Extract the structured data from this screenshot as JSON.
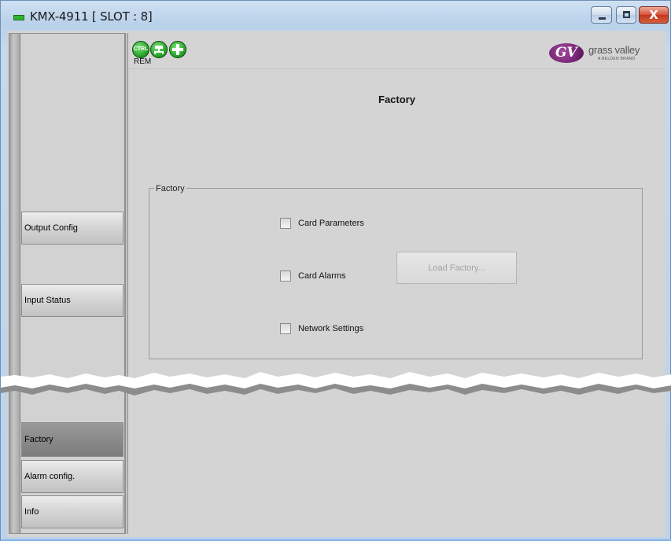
{
  "window": {
    "title": "KMX-4911 [ SLOT : 8]",
    "controls": {
      "minimize_icon": "minimize-icon",
      "maximize_icon": "maximize-icon",
      "close_glyph": "X"
    }
  },
  "status_icons": {
    "ctrl_text": "CTRL",
    "rem_text": "REM",
    "icons": [
      "ctrl-status-icon",
      "network-status-icon",
      "health-status-icon"
    ]
  },
  "logo": {
    "mark": "GV",
    "name": "grass valley",
    "tagline": "A BELDEN BRAND"
  },
  "nav": {
    "items": [
      {
        "label": "Output Config",
        "active": false
      },
      {
        "label": "Input Status",
        "active": false
      },
      {
        "label": "Factory",
        "active": true
      },
      {
        "label": "Alarm config.",
        "active": false
      },
      {
        "label": "Info",
        "active": false
      }
    ]
  },
  "main": {
    "title": "Factory",
    "group_label": "Factory",
    "checkboxes": [
      {
        "label": "Card Parameters",
        "checked": false
      },
      {
        "label": "Card Alarms",
        "checked": false
      },
      {
        "label": "Network Settings",
        "checked": false
      }
    ],
    "load_button": "Load Factory..."
  },
  "colors": {
    "led_green": "#2fb52f",
    "logo_purple": "#6d1f6b",
    "close_red": "#c3351f",
    "panel_gray": "#d4d4d4"
  }
}
